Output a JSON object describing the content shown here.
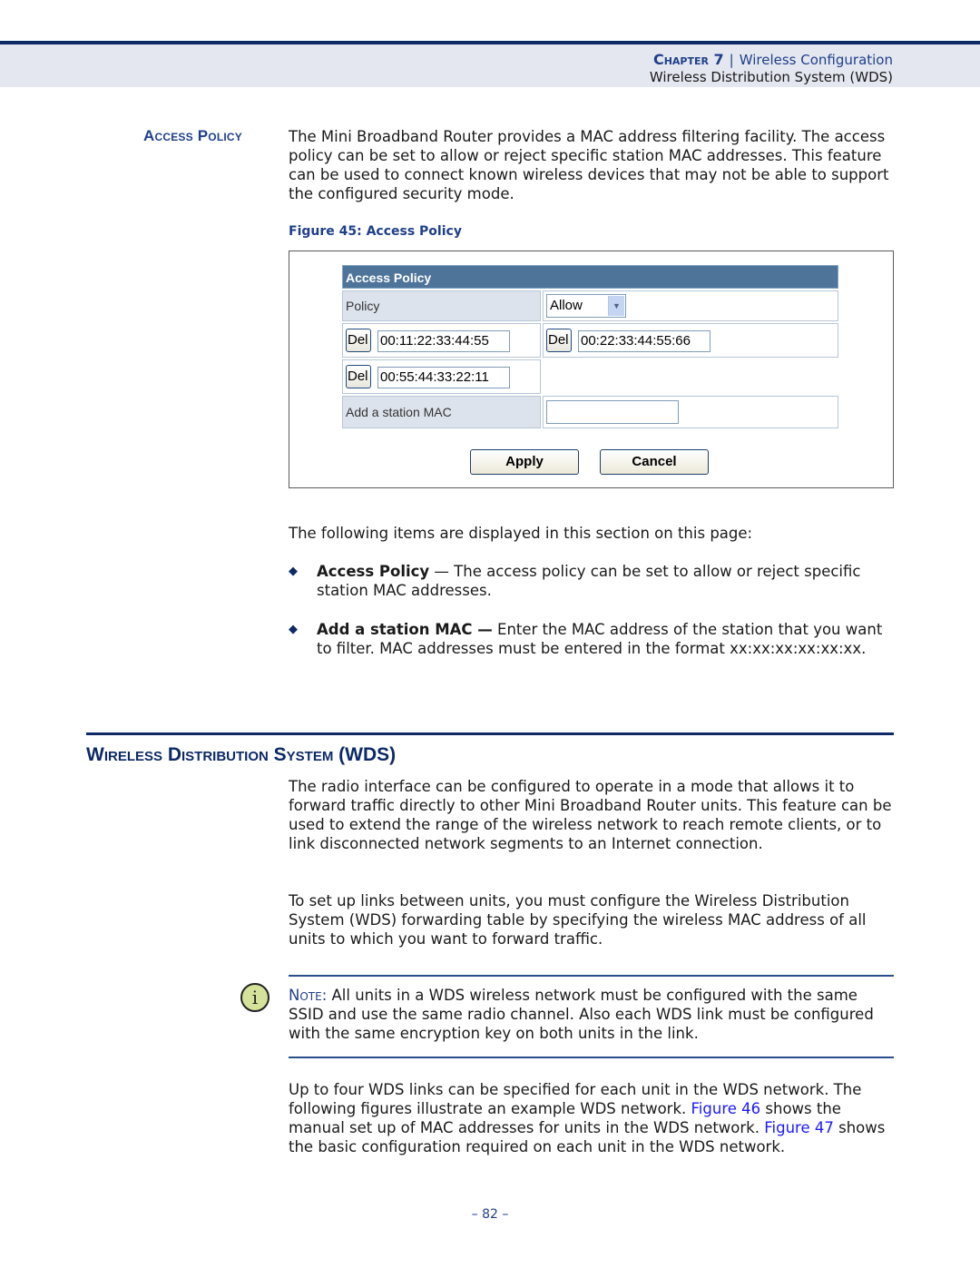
{
  "header": {
    "chapter_label": "Chapter 7",
    "separator": "|",
    "chapter_title": "Wireless Configuration",
    "section_title": "Wireless Distribution System (WDS)"
  },
  "access_policy": {
    "side_heading": "Access Policy",
    "intro": "The Mini Broadband Router provides a MAC address filtering facility. The access policy can be set to allow or reject specific station MAC addresses. This feature can be used to connect known wireless devices that may not be able to support the configured security mode.",
    "figure_caption": "Figure 45:  Access Policy",
    "figure": {
      "panel_title": "Access Policy",
      "policy_label": "Policy",
      "policy_value": "Allow",
      "del_label": "Del",
      "mac_entries": [
        "00:11:22:33:44:55",
        "00:22:33:44:55:66",
        "00:55:44:33:22:11"
      ],
      "add_label": "Add a station MAC",
      "add_value": "",
      "apply_label": "Apply",
      "cancel_label": "Cancel"
    },
    "items_intro": "The following items are displayed in this section on this page:",
    "items": [
      {
        "term": "Access Policy",
        "desc": " — The access policy can be set to allow or reject specific station MAC addresses."
      },
      {
        "term": "Add a station MAC —",
        "desc": " Enter the MAC address of the station that you want to filter. MAC addresses must be entered in the format xx:xx:xx:xx:xx:xx."
      }
    ]
  },
  "wds": {
    "heading": "Wireless Distribution System (WDS)",
    "para1": "The radio interface can be configured to operate in a mode that allows it to forward traffic directly to other Mini Broadband Router units. This feature can be used to extend the range of the wireless network to reach remote clients, or to link disconnected network segments to an Internet connection.",
    "para2": "To set up links between units, you must configure the Wireless Distribution System (WDS) forwarding table by specifying the wireless MAC address of all units to which you want to forward traffic.",
    "note_label": "Note:",
    "note_text": " All units in a WDS wireless network must be configured with the same SSID and use the same radio channel. Also each WDS link must be configured with the same encryption key on both units in the link.",
    "para3_a": "Up to four WDS links can be specified for each unit in the WDS network. The following figures illustrate an example WDS network. ",
    "link_fig46": "Figure 46",
    "para3_b": " shows the manual set up of MAC addresses for units in the WDS network. ",
    "link_fig47": "Figure 47",
    "para3_c": " shows the basic configuration required on each unit in the WDS network."
  },
  "icons": {
    "note": "info-icon",
    "bullet": "diamond-bullet-icon",
    "dropdown": "chevron-down-icon"
  },
  "colors": {
    "brand_navy": "#0d2a66",
    "heading_blue": "#1f3f8a",
    "panel_header": "#4f7499",
    "link": "#1a1aff"
  },
  "footer": {
    "page_number": "–  82  –"
  }
}
